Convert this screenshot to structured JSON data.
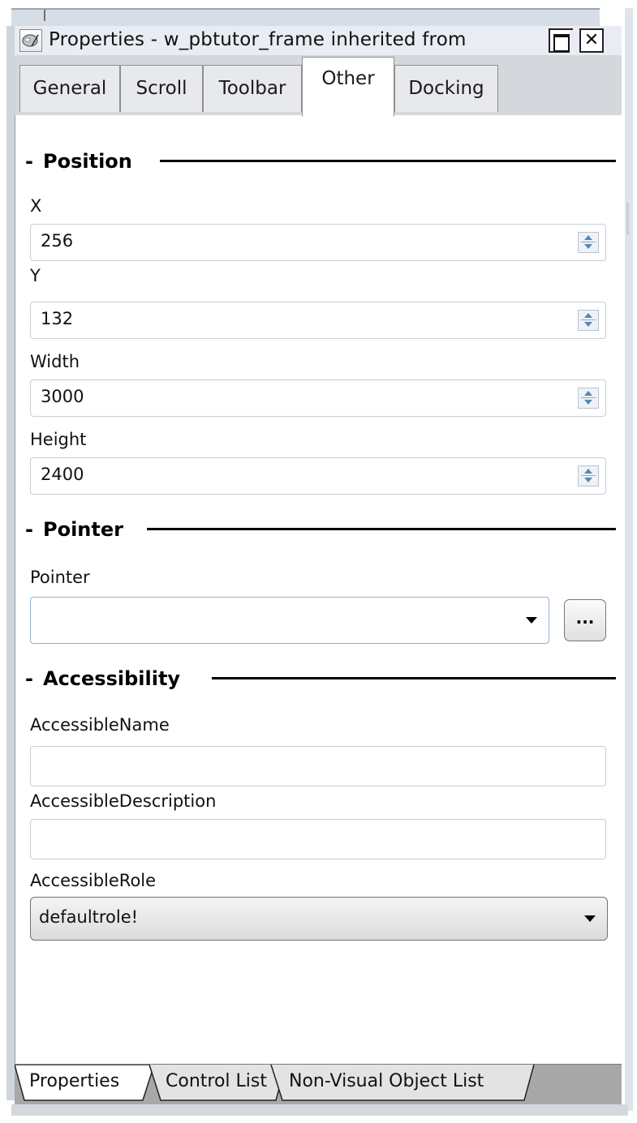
{
  "window": {
    "title": "Properties - w_pbtutor_frame inherited from",
    "restore_label": "",
    "close_label": "✕"
  },
  "tabs": [
    {
      "label": "General",
      "active": false
    },
    {
      "label": "Scroll",
      "active": false
    },
    {
      "label": "Toolbar",
      "active": false
    },
    {
      "label": "Other",
      "active": true
    },
    {
      "label": "Docking",
      "active": false
    }
  ],
  "sections": {
    "position": "Position",
    "pointer": "Pointer",
    "accessibility": "Accessibility"
  },
  "position": {
    "x_label": "X",
    "x_value": "256",
    "y_label": "Y",
    "y_value": "132",
    "width_label": "Width",
    "width_value": "3000",
    "height_label": "Height",
    "height_value": "2400"
  },
  "pointer": {
    "label": "Pointer",
    "value": "",
    "ellipsis_label": "..."
  },
  "accessibility": {
    "name_label": "AccessibleName",
    "name_value": "",
    "description_label": "AccessibleDescription",
    "description_value": "",
    "role_label": "AccessibleRole",
    "role_value": "defaultrole!"
  },
  "bottom_tabs": [
    {
      "label": "Properties",
      "active": true
    },
    {
      "label": "Control List",
      "active": false
    },
    {
      "label": "Non-Visual Object List",
      "active": false
    }
  ]
}
